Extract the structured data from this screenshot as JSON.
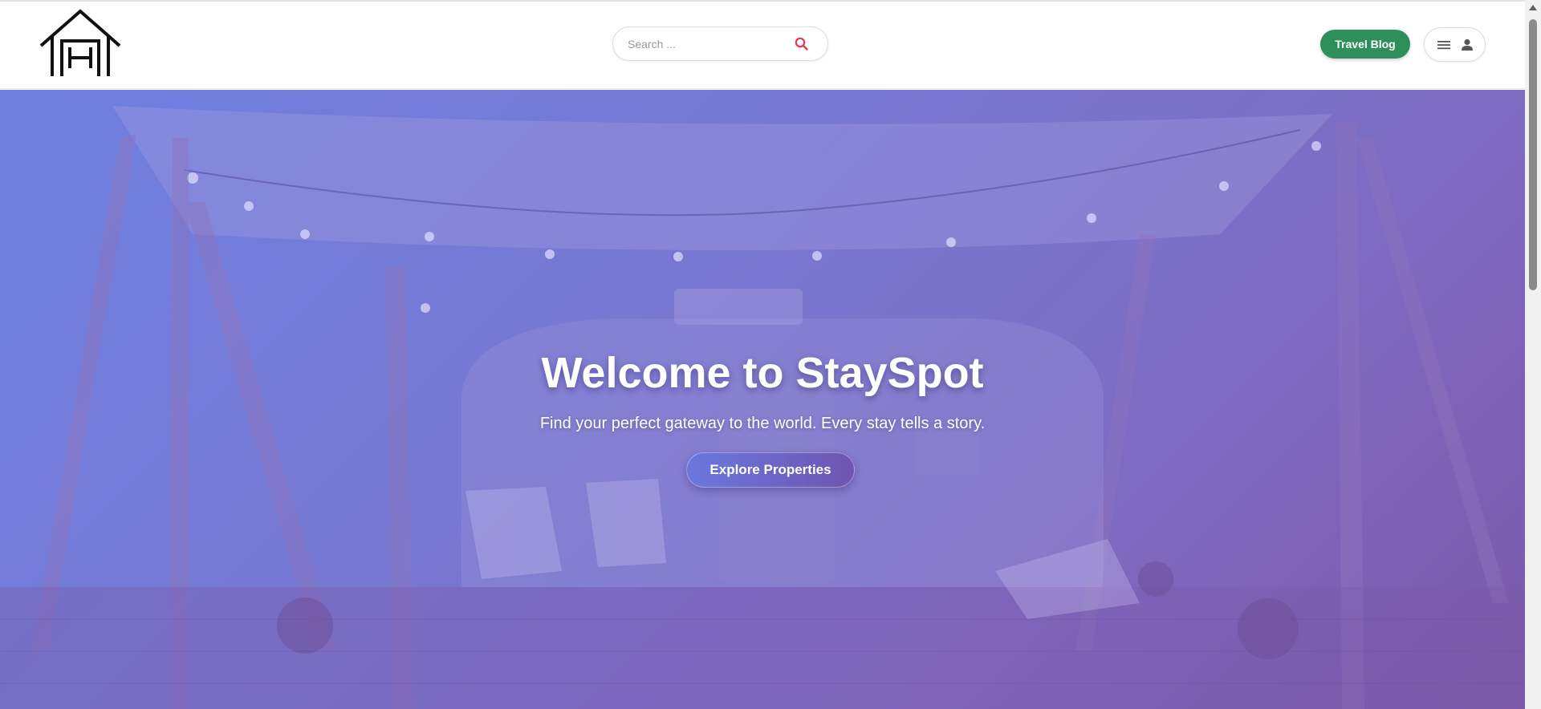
{
  "header": {
    "logo_icon": "house-h-logo-icon",
    "search": {
      "placeholder": "Search ...",
      "value": "",
      "icon": "search-icon",
      "icon_color": "#e8384f"
    },
    "travel_blog_label": "Travel Blog",
    "travel_blog_color": "#2f8f5b",
    "user_menu": {
      "menu_icon": "hamburger-menu-icon",
      "user_icon": "person-icon"
    }
  },
  "hero": {
    "title": "Welcome to StaySpot",
    "subtitle": "Find your perfect gateway to the world. Every stay tells a story.",
    "cta_label": "Explore Properties",
    "overlay_colors": [
      "#6f80e0",
      "#7b58a8"
    ]
  },
  "scrollbar": {
    "thumb_color": "#8a8a8a"
  }
}
